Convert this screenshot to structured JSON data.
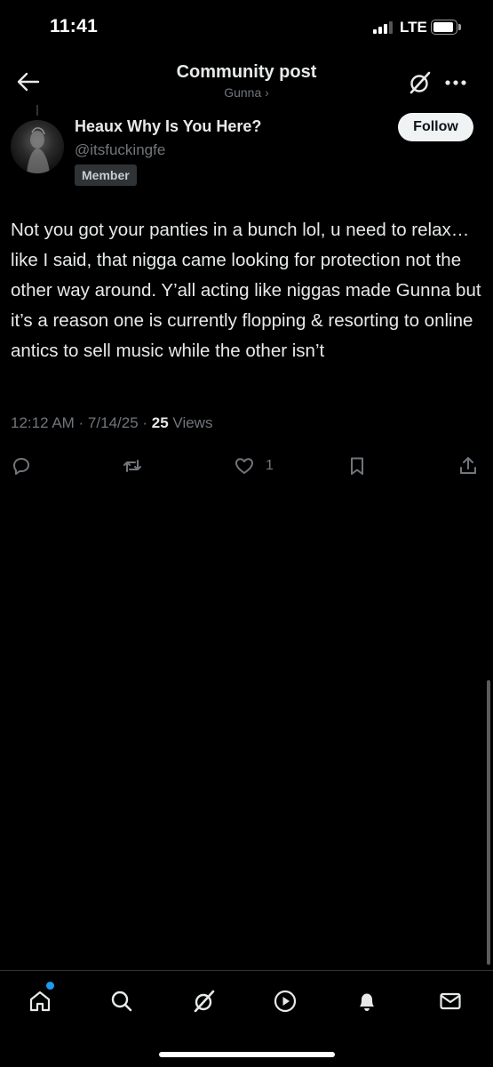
{
  "status_bar": {
    "time": "11:41",
    "network": "LTE",
    "battery_level": 0.85,
    "signal_bars": 3
  },
  "header": {
    "title": "Community post",
    "community_name": "Gunna ›"
  },
  "post": {
    "display_name": "Heaux Why Is You Here?",
    "handle": "@itsfuckingfe",
    "badge": "Member",
    "follow_label": "Follow",
    "text": "Not you got your panties in a bunch lol, u need to relax…like I said, that nigga came looking for protection not the other way around. Y’all acting like niggas made Gunna but it’s a reason one is currently flopping & resorting to online antics to sell music while the other isn’t",
    "timestamp": "12:12 AM · 7/14/25 · ",
    "views_count": "25",
    "views_label": " Views",
    "likes": "1"
  },
  "icons": {
    "back": "arrow-left-icon",
    "grok": "grok-icon",
    "more": "more-horizontal-icon",
    "reply": "reply-icon",
    "repost": "repost-icon",
    "like": "heart-icon",
    "bookmark": "bookmark-icon",
    "share": "share-icon"
  },
  "tabs": [
    "home",
    "search",
    "grok",
    "video",
    "notifications",
    "messages"
  ],
  "colors": {
    "background": "#000000",
    "text": "#e7e9ea",
    "muted": "#71767b",
    "accent": "#1d9bf0",
    "follow_button": "#eff3f4"
  }
}
